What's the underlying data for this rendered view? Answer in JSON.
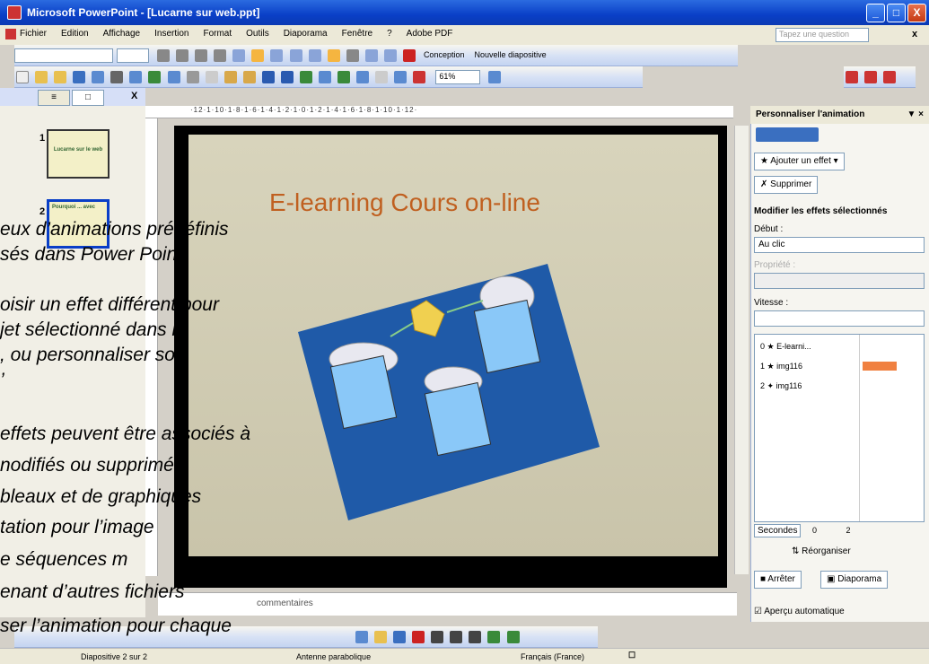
{
  "window": {
    "title": "Microsoft PowerPoint - [Lucarne sur web.ppt]",
    "min": "_",
    "max": "□",
    "close": "X"
  },
  "menu": {
    "items": [
      "Fichier",
      "Edition",
      "Affichage",
      "Insertion",
      "Format",
      "Outils",
      "Diaporama",
      "Fenêtre",
      "?",
      "Adobe PDF"
    ],
    "question_placeholder": "Tapez une question",
    "close_x": "x"
  },
  "toolbar1": {
    "conception": "Conception",
    "nouvelle": "Nouvelle diapositive"
  },
  "toolbar2": {
    "zoom": "61%"
  },
  "leftpane": {
    "tab1": "≡",
    "tab2": "□",
    "close": "X",
    "slide1_num": "1",
    "slide2_num": "2",
    "thumb1_text": "Lucarne sur le web",
    "thumb2_text": "Pourquoi ... avec"
  },
  "ruler": "·12·1·10·1·8·1·6·1·4·1·2·1·0·1·2·1·4·1·6·1·8·1·10·1·12·",
  "slide": {
    "title": "E-learning   Cours on-line"
  },
  "notes": {
    "placeholder": "Cliquez pour ajouter des commentaires",
    "visible": "commentaires"
  },
  "taskpane": {
    "title": "Personnaliser l'animation",
    "add_effect": "Ajouter un effet",
    "delete": "Supprimer",
    "modify_header": "Modifier les effets sélectionnés",
    "start_label": "Début :",
    "start_value": "Au clic",
    "property_label": "Propriété :",
    "speed_label": "Vitesse :",
    "items": [
      {
        "num": "0",
        "name": "E-learni..."
      },
      {
        "num": "1",
        "name": "img116"
      },
      {
        "num": "2",
        "name": "img116"
      }
    ],
    "seconds": "Secondes",
    "timeline": [
      "0",
      "2"
    ],
    "reorder": "Réorganiser",
    "stop": "Arrêter",
    "slideshow": "Diaporama",
    "autopreview": "Aperçu automatique"
  },
  "statusbar": {
    "slide": "Diapositive 2 sur 2",
    "design": "Antenne parabolique",
    "lang": "Français (France)"
  },
  "overlay": [
    "eux d’animations prédéfinis",
    "sés dans Power Point",
    "oisir un effet différent pour",
    "jet sélectionné dans la",
    ", ou personnaliser son",
    "’",
    "effets peuvent être associés à",
    "nodifiés ou supprimés.",
    "bleaux et de graphiques",
    "tation pour l’image",
    "e séquences m",
    "enant d’autres fichiers",
    "ser l’animation pour chaque"
  ],
  "colors": {
    "titlebar": "#0a3fc7",
    "slidebg": "#d8d4bc",
    "slidetitle": "#c06020",
    "panel": "#1f5aa8"
  }
}
